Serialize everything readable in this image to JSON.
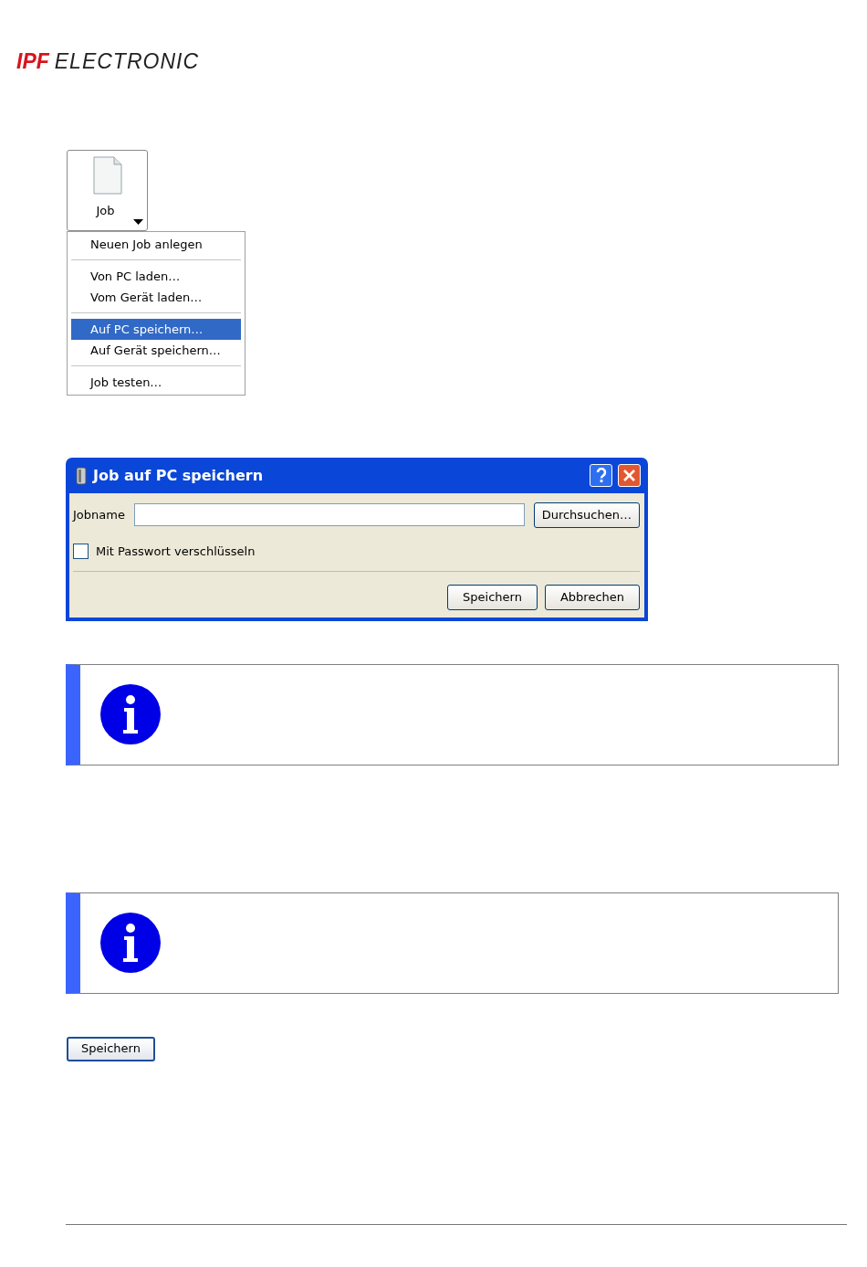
{
  "logo": {
    "mark": "IPF",
    "name": "ELECTRONIC"
  },
  "job_button": {
    "label": "Job"
  },
  "job_menu": {
    "groups": [
      {
        "items": [
          {
            "label": "Neuen Job anlegen",
            "selected": false
          }
        ]
      },
      {
        "items": [
          {
            "label": "Von PC laden…",
            "selected": false
          },
          {
            "label": "Vom Gerät laden…",
            "selected": false
          }
        ]
      },
      {
        "items": [
          {
            "label": "Auf PC speichern…",
            "selected": true
          },
          {
            "label": "Auf Gerät speichern…",
            "selected": false
          }
        ]
      },
      {
        "items": [
          {
            "label": "Job testen…",
            "selected": false
          }
        ]
      }
    ]
  },
  "dialog": {
    "title": "Job auf PC speichern",
    "jobname_label": "Jobname",
    "browse_button": "Durchsuchen…",
    "password_checkbox": {
      "label": "Mit Passwort verschlüsseln",
      "checked": false
    },
    "buttons": [
      "Speichern",
      "Abbrechen"
    ]
  },
  "notes": [
    {
      "kind": "info"
    },
    {
      "kind": "info"
    }
  ],
  "save_button": {
    "label": "Speichern"
  }
}
